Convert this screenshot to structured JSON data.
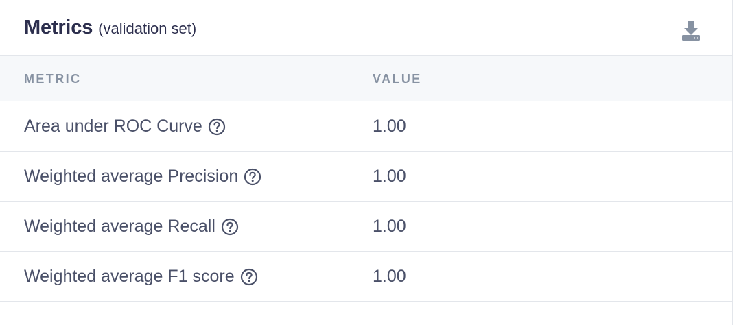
{
  "panel": {
    "title": "Metrics",
    "subtitle": "(validation set)"
  },
  "table": {
    "columns": [
      "METRIC",
      "VALUE"
    ],
    "rows": [
      {
        "metric": "Area under ROC Curve",
        "value": "1.00"
      },
      {
        "metric": "Weighted average Precision",
        "value": "1.00"
      },
      {
        "metric": "Weighted average Recall",
        "value": "1.00"
      },
      {
        "metric": "Weighted average F1 score",
        "value": "1.00"
      }
    ]
  },
  "icons": {
    "download": "download-icon",
    "help": "help-circle-icon"
  },
  "colors": {
    "title": "#2d2f4e",
    "text": "#4a5068",
    "header_bg": "#f6f8fa",
    "column_header": "#8792a2",
    "border": "#e3e6eb",
    "icon": "#8792a2"
  }
}
